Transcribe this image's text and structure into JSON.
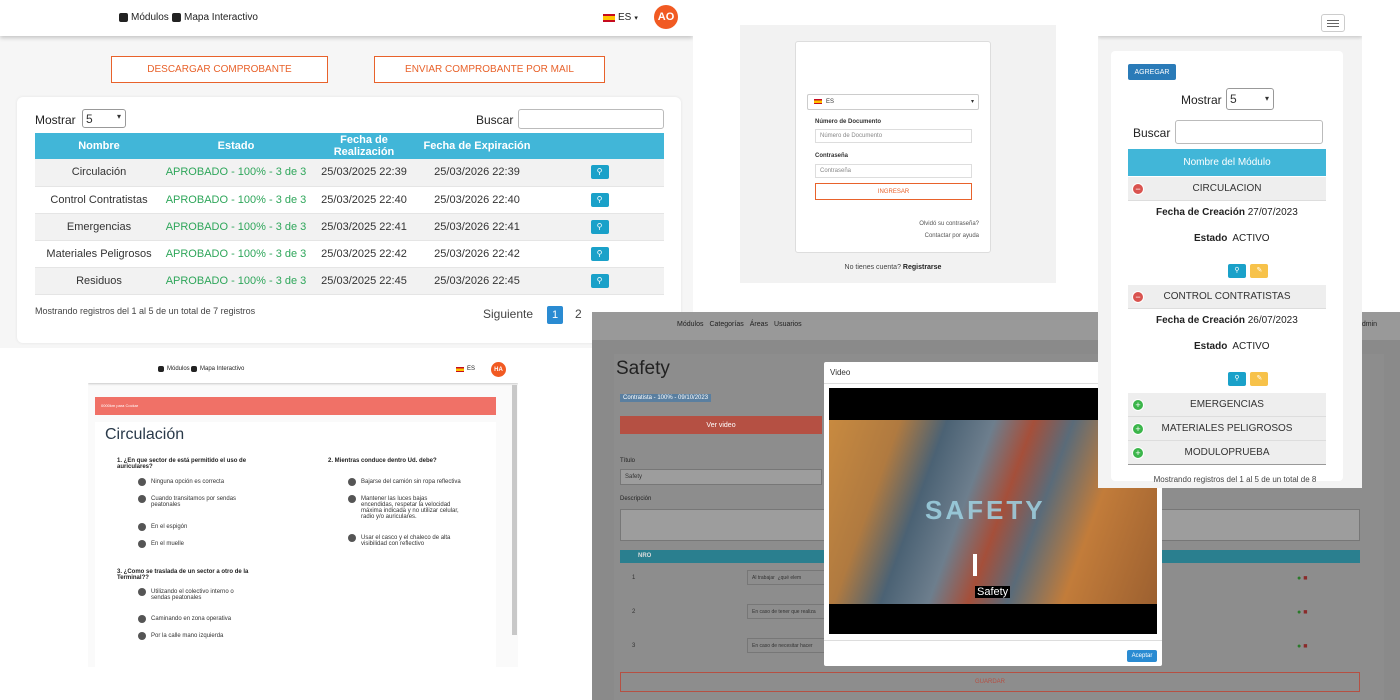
{
  "panelA": {
    "nav": {
      "modules": "Módulos",
      "map": "Mapa Interactivo",
      "lang": "ES",
      "avatar": "AO"
    },
    "btn_download": "DESCARGAR COMPROBANTE",
    "btn_mail": "ENVIAR COMPROBANTE POR MAIL",
    "show_label": "Mostrar",
    "show_value": "5",
    "search_label": "Buscar",
    "columns": [
      "Nombre",
      "Estado",
      "Fecha de Realización",
      "Fecha de Expiración"
    ],
    "rows": [
      {
        "name": "Circulación",
        "status": "APROBADO - 100% - 3 de 3",
        "done": "25/03/2025 22:39",
        "exp": "25/03/2026 22:39"
      },
      {
        "name": "Control Contratistas",
        "status": "APROBADO - 100% - 3 de 3",
        "done": "25/03/2025 22:40",
        "exp": "25/03/2026 22:40"
      },
      {
        "name": "Emergencias",
        "status": "APROBADO - 100% - 3 de 3",
        "done": "25/03/2025 22:41",
        "exp": "25/03/2026 22:41"
      },
      {
        "name": "Materiales Peligrosos",
        "status": "APROBADO - 100% - 3 de 3",
        "done": "25/03/2025 22:42",
        "exp": "25/03/2026 22:42"
      },
      {
        "name": "Residuos",
        "status": "APROBADO - 100% - 3 de 3",
        "done": "25/03/2025 22:45",
        "exp": "25/03/2026 22:45"
      }
    ],
    "footer": "Mostrando registros del 1 al 5 de un total de 7 registros",
    "next": "Siguiente",
    "page1": "1",
    "page2": "2"
  },
  "panelB": {
    "lang": "ES",
    "doc_label": "Número de Documento",
    "doc_placeholder": "Número de Documento",
    "pass_label": "Contraseña",
    "pass_placeholder": "Contraseña",
    "login": "INGRESAR",
    "forgot": "Olvidó su contraseña?",
    "help": "Contactar por ayuda",
    "no_account": "No tienes cuenta?",
    "register": "Registrarse"
  },
  "panelC": {
    "add": "AGREGAR",
    "show_label": "Mostrar",
    "show_value": "5",
    "search_label": "Buscar",
    "header": "Nombre del Módulo",
    "created_label": "Fecha de Creación",
    "state_label": "Estado",
    "modules": [
      {
        "name": "CIRCULACION",
        "date": "27/07/2023",
        "state": "ACTIVO"
      },
      {
        "name": "CONTROL CONTRATISTAS",
        "date": "26/07/2023",
        "state": "ACTIVO"
      },
      {
        "name": "EMERGENCIAS"
      },
      {
        "name": "MATERIALES PELIGROSOS"
      },
      {
        "name": "MODULOPRUEBA"
      }
    ],
    "footer": "Mostrando registros del 1 al 5 de un total de 8"
  },
  "panelD": {
    "nav": {
      "modules": "Módulos",
      "map": "Mapa Interactivo",
      "lang": "ES",
      "avatar": "HA"
    },
    "alert": "0000km para Cockar",
    "title": "Circulación",
    "q1": {
      "text": "1. ¿En que sector de está permitido el uso de auriculares?",
      "options": [
        "Ninguna opción es correcta",
        "Cuando transitamos por sendas peatonales",
        "En el espigón",
        "En el muelle"
      ]
    },
    "q2": {
      "text": "2. Mientras conduce dentro Ud. debe?",
      "options": [
        "Bajarse del camión sin ropa reflectiva",
        "Mantener las luces bajas encendidas, respetar la velocidad máxima indicada y no utilizar celular, radio y/o auriculares.",
        "Usar el casco y el chaleco de alta visibilidad con reflectivo"
      ]
    },
    "q3": {
      "text": "3. ¿Como se traslada de un sector a otro de la Terminal??",
      "options": [
        "Utilizando el colectivo interno o sendas peatonales",
        "Caminando en zona operativa",
        "Por la calle mano izquierda"
      ]
    }
  },
  "panelE": {
    "nav": [
      "Módulos",
      "Categorías",
      "Áreas",
      "Usuarios"
    ],
    "admin": "admin",
    "title": "Safety",
    "badge": "Contratista - 100% - 09/10/2023",
    "see_video": "Ver video",
    "title_label": "Título",
    "title_value": "Safety",
    "desc_label": "Descripción",
    "col_nro": "NRO",
    "rows": [
      {
        "n": "1",
        "q": "Al trabajar",
        "q2": "¿qué elem"
      },
      {
        "n": "2",
        "q": "En caso de tener que realiza"
      },
      {
        "n": "3",
        "q": "En caso de necesitar hacer"
      }
    ],
    "save": "GUARDAR",
    "modal": {
      "title": "Video",
      "caption": "Safety",
      "overlay": "SAFETY",
      "accept": "Aceptar"
    }
  }
}
